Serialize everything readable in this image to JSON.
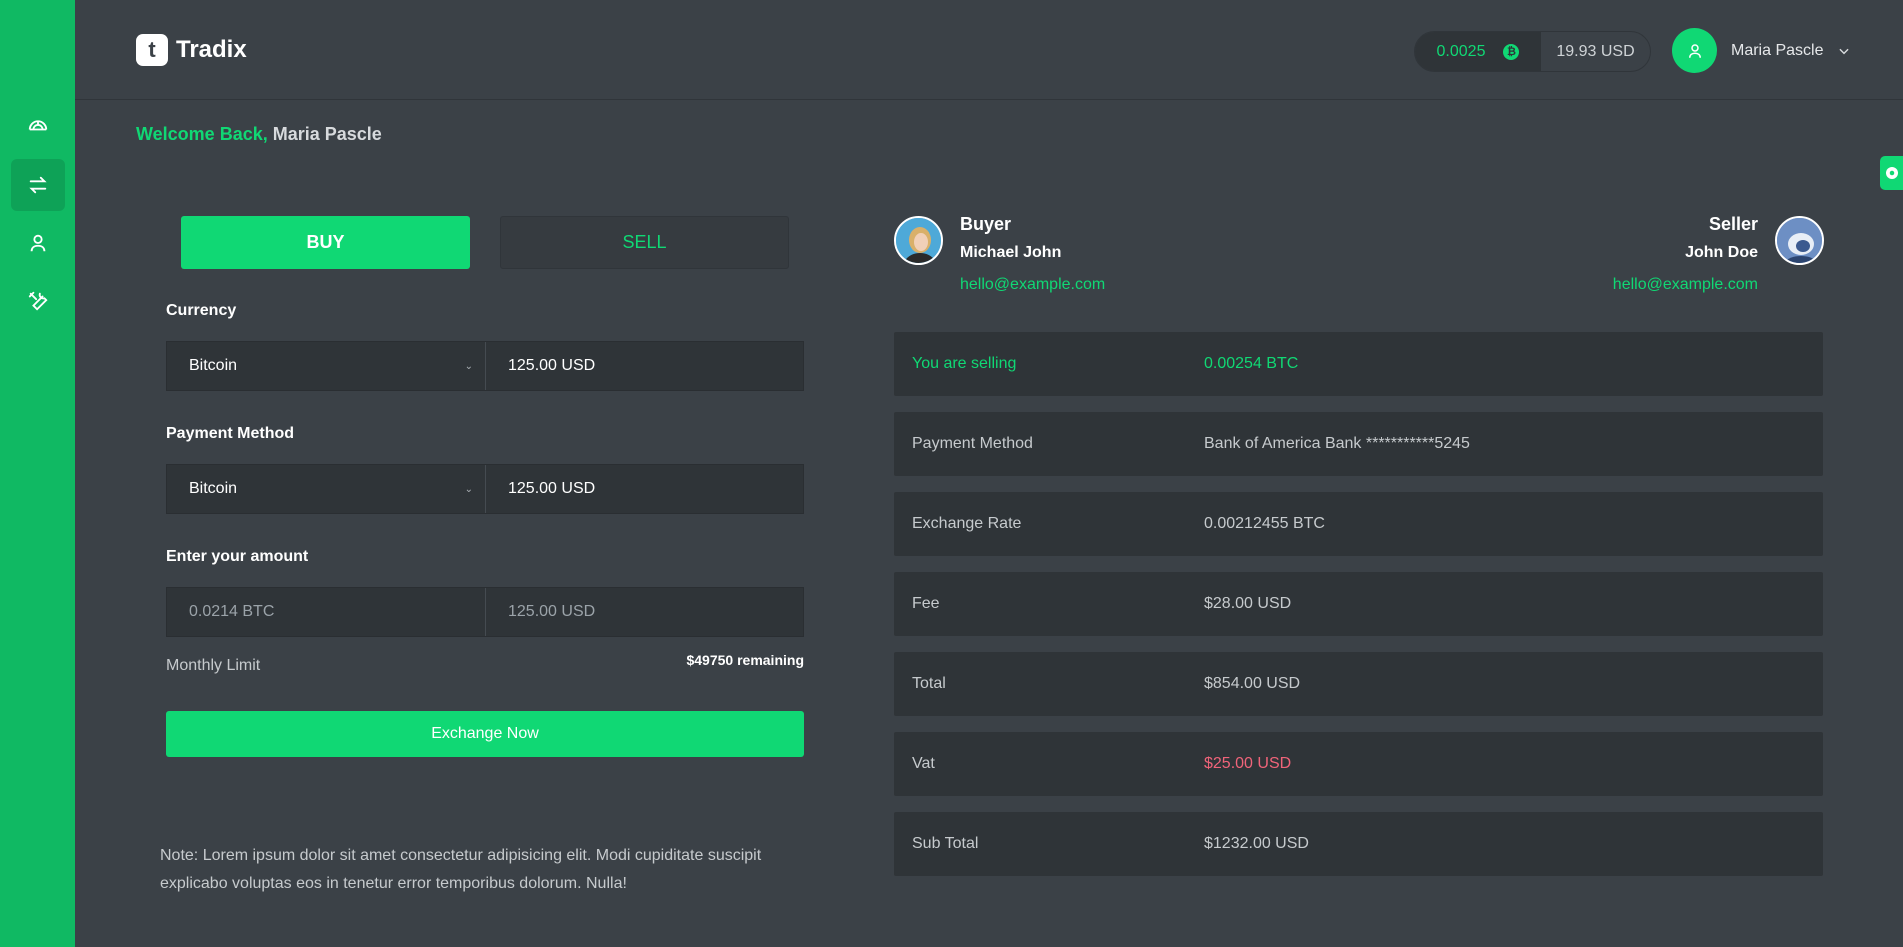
{
  "app": {
    "name": "Tradix",
    "logo_letter": "t"
  },
  "colors": {
    "accent": "#10d874",
    "sidebar": "#10b963",
    "background": "#3b4147",
    "panel": "#2f3438",
    "negative": "#f0647a"
  },
  "sidebar": {
    "items": [
      {
        "name": "dashboard",
        "icon": "dashboard-icon",
        "active": false
      },
      {
        "name": "exchange",
        "icon": "exchange-arrows-icon",
        "active": true
      },
      {
        "name": "profile",
        "icon": "user-icon",
        "active": false
      },
      {
        "name": "settings",
        "icon": "tools-icon",
        "active": false
      }
    ]
  },
  "header": {
    "btc_balance": "0.0025",
    "usd_balance": "19.93 USD",
    "user_name": "Maria Pascle"
  },
  "welcome": {
    "greeting": "Welcome Back,",
    "name": "Maria Pascle"
  },
  "trade_form": {
    "buy_label": "BUY",
    "sell_label": "SELL",
    "currency_label": "Currency",
    "currency_selected": "Bitcoin",
    "currency_value": "125.00 USD",
    "payment_label": "Payment Method",
    "payment_selected": "Bitcoin",
    "payment_value": "125.00 USD",
    "amount_label": "Enter your amount",
    "amount_btc_placeholder": "0.0214 BTC",
    "amount_usd_placeholder": "125.00 USD",
    "monthly_limit_label": "Monthly Limit",
    "remaining": "$49750 remaining",
    "exchange_button": "Exchange Now",
    "note": "Note: Lorem ipsum dolor sit amet consectetur adipisicing elit. Modi cupiditate suscipit explicabo voluptas eos in tenetur error temporibus dolorum. Nulla!"
  },
  "buyer": {
    "role": "Buyer",
    "name": "Michael John",
    "email": "hello@example.com"
  },
  "seller": {
    "role": "Seller",
    "name": "John Doe",
    "email": "hello@example.com"
  },
  "details": [
    {
      "label": "You are selling",
      "value": "0.00254 BTC"
    },
    {
      "label": "Payment Method",
      "value": "Bank of America Bank ***********5245"
    },
    {
      "label": "Exchange Rate",
      "value": "0.00212455 BTC"
    },
    {
      "label": "Fee",
      "value": "$28.00 USD"
    },
    {
      "label": "Total",
      "value": "$854.00 USD"
    },
    {
      "label": "Vat",
      "value": "$25.00 USD"
    },
    {
      "label": "Sub Total",
      "value": "$1232.00 USD"
    }
  ]
}
